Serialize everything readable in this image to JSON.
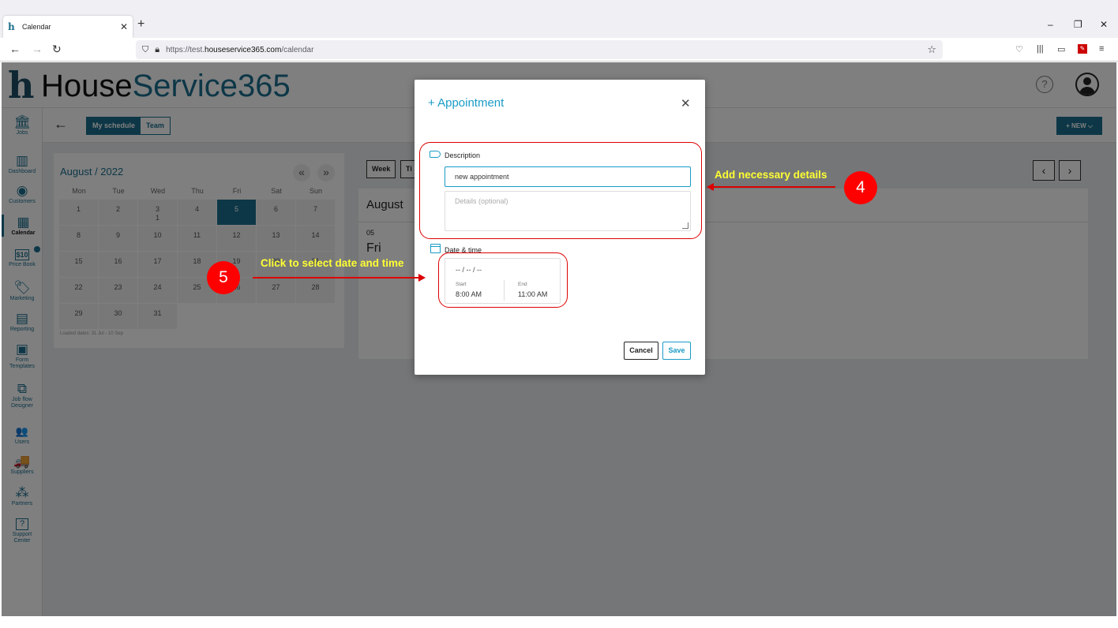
{
  "browser": {
    "tab_title": "Calendar",
    "tab_close": "✕",
    "new_tab": "+",
    "url_scheme": "https://test.",
    "url_host": "houseservice365.com",
    "url_path": "/calendar",
    "win_min": "–",
    "win_restore": "❐",
    "win_close": "✕"
  },
  "app": {
    "logo_letter": "h",
    "logo_part1": "House",
    "logo_part2": "Service365",
    "help": "?"
  },
  "sidebar": {
    "items": [
      {
        "label": "Jobs",
        "glyph": "🏛"
      },
      {
        "label": "Dashboard",
        "glyph": "▥"
      },
      {
        "label": "Customers",
        "glyph": "◉"
      },
      {
        "label": "Calendar",
        "glyph": "▦"
      },
      {
        "label": "Price Book",
        "glyph": "$10"
      },
      {
        "label": "Marketing",
        "glyph": "🏷"
      },
      {
        "label": "Reporting",
        "glyph": "▤"
      },
      {
        "label": "Form Templates",
        "glyph": "▣"
      },
      {
        "label": "Job flow Designer",
        "glyph": "⧉"
      },
      {
        "label": "Users",
        "glyph": "👥"
      },
      {
        "label": "Suppliers",
        "glyph": "🚚"
      },
      {
        "label": "Partners",
        "glyph": "⁂"
      },
      {
        "label": "Support Center",
        "glyph": "?"
      }
    ]
  },
  "subheader": {
    "back": "←",
    "my_schedule": "My schedule",
    "team": "Team",
    "new": "+ NEW ⌵"
  },
  "calendar": {
    "title": "August / 2022",
    "prev": "«",
    "next": "»",
    "days_of_week": [
      "Mon",
      "Tue",
      "Wed",
      "Thu",
      "Fri",
      "Sat",
      "Sun"
    ],
    "weeks": [
      [
        "1",
        "2",
        "3",
        "4",
        "5",
        "6",
        "7"
      ],
      [
        "8",
        "9",
        "10",
        "11",
        "12",
        "13",
        "14"
      ],
      [
        "15",
        "16",
        "17",
        "18",
        "19",
        "20",
        "21"
      ],
      [
        "22",
        "23",
        "24",
        "25",
        "26",
        "27",
        "28"
      ],
      [
        "29",
        "30",
        "31",
        "",
        "",
        "",
        ""
      ]
    ],
    "badge_on_3": "1",
    "selected_day": "5",
    "loaded_dates": "Loaded dates: 31 Jul - 10 Sep"
  },
  "schedule": {
    "week": "Week",
    "timeline_partial": "Ti",
    "month": "August",
    "day_num": "05",
    "day_name": "Fri",
    "prev": "‹",
    "next": "›"
  },
  "modal": {
    "title": "+ Appointment",
    "close": "✕",
    "description_label": "Description",
    "description_value": "new appointment",
    "details_placeholder": "Details (optional)",
    "datetime_label": "Date & time",
    "date_value": "-- / -- / --",
    "start_label": "Start",
    "start_value": "8:00 AM",
    "end_label": "End",
    "end_value": "11:00 AM",
    "cancel": "Cancel",
    "save": "Save"
  },
  "annotations": {
    "step4_text": "Add necessary details",
    "step4_number": "4",
    "step5_text": "Click to select date and time",
    "step5_number": "5"
  },
  "colors": {
    "brand": "#1a6e8e",
    "accent": "#1a9bc7",
    "annotation_red": "#ff0000",
    "annotation_text": "#ffff33"
  }
}
